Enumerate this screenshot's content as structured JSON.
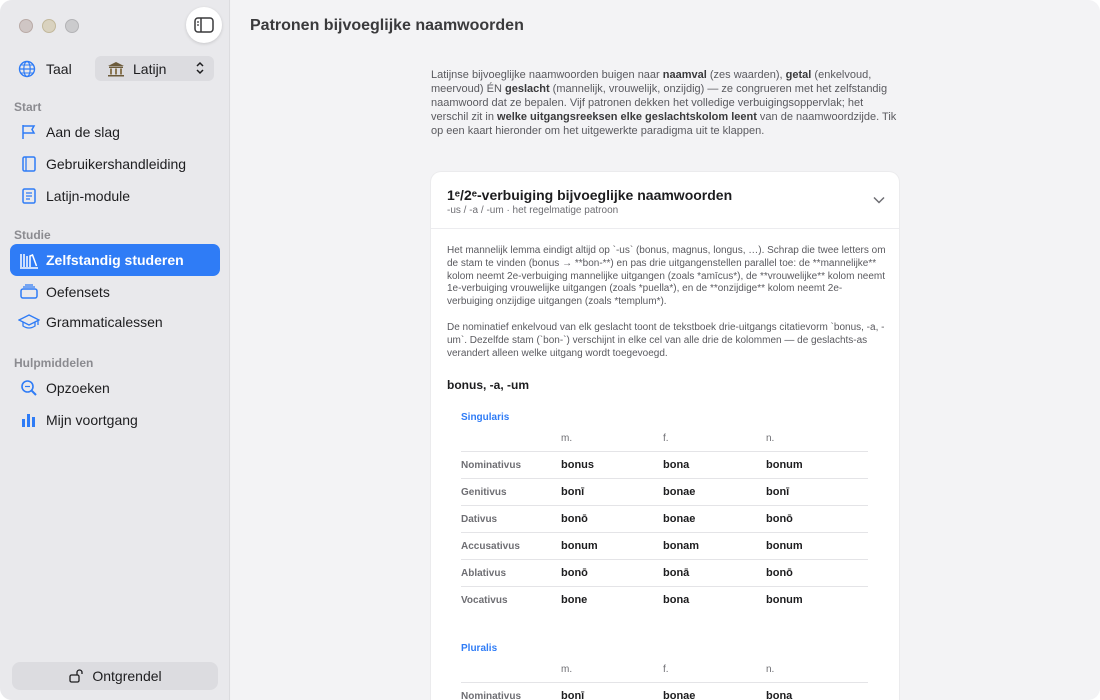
{
  "sidebar": {
    "language_label": "Taal",
    "language_value": "Latijn",
    "sections": {
      "start": "Start",
      "studie": "Studie",
      "hulpmiddelen": "Hulpmiddelen"
    },
    "items": [
      {
        "label": "Aan de slag",
        "icon": "flag-icon"
      },
      {
        "label": "Gebruikershandleiding",
        "icon": "book-icon"
      },
      {
        "label": "Latijn-module",
        "icon": "document-icon"
      },
      {
        "label": "Zelfstandig studeren",
        "icon": "library-icon",
        "active": true
      },
      {
        "label": "Oefensets",
        "icon": "stack-icon"
      },
      {
        "label": "Grammaticalessen",
        "icon": "graduation-cap-icon"
      },
      {
        "label": "Opzoeken",
        "icon": "magnifier-icon"
      },
      {
        "label": "Mijn voortgang",
        "icon": "bar-chart-icon"
      }
    ],
    "unlock_label": "Ontgrendel"
  },
  "main": {
    "title": "Patronen bijvoeglijke naamwoorden",
    "intro": {
      "t1": "Latijnse bijvoeglijke naamwoorden buigen naar ",
      "b1": "naamval",
      "t2": " (zes waarden), ",
      "b2": "getal",
      "t3": " (enkelvoud, meervoud) ÉN ",
      "b3": "geslacht",
      "t4": " (mannelijk, vrouwelijk, onzijdig) — ze congrueren met het zelfstandig naamwoord dat ze bepalen. Vijf patronen dekken het volledige verbuigingsoppervlak; het verschil zit in ",
      "b4": "welke uitgangsreeksen elke geslachtskolom leent",
      "t5": " van de naamwoordzijde. Tik op een kaart hieronder om het uitgewerkte paradigma uit te klappen."
    },
    "card": {
      "title": "1ᵉ/2ᵉ-verbuiging bijvoeglijke naamwoorden",
      "subtitle": "-us / -a / -um · het regelmatige patroon",
      "p1": "Het mannelijk lemma eindigt altijd op `-us` (bonus, magnus, longus, …). Schrap die twee letters om de stam te vinden (bonus → **bon-**) en pas drie uitgangenstellen parallel toe: de **mannelijke** kolom neemt 2e-verbuiging mannelijke uitgangen (zoals *amīcus*), de **vrouwelijke** kolom neemt 1e-verbuiging vrouwelijke uitgangen (zoals *puella*), en de **onzijdige** kolom neemt 2e-verbuiging onzijdige uitgangen (zoals *templum*).",
      "p2": "De nominatief enkelvoud van elk geslacht toont de tekstboek drie-uitgangs citatievorm `bonus, -a, -um`. Dezelfde stam (`bon-`) verschijnt in elke cel van alle drie de kolommen — de geslachts-as verandert alleen welke uitgang wordt toegevoegd.",
      "lemma": "bonus, -a, -um",
      "columns": [
        "m.",
        "f.",
        "n."
      ],
      "singular": {
        "label": "Singularis",
        "rows": [
          {
            "case": "Nominativus",
            "m": "bonus",
            "f": "bona",
            "n": "bonum"
          },
          {
            "case": "Genitivus",
            "m": "bonī",
            "f": "bonae",
            "n": "bonī"
          },
          {
            "case": "Dativus",
            "m": "bonō",
            "f": "bonae",
            "n": "bonō"
          },
          {
            "case": "Accusativus",
            "m": "bonum",
            "f": "bonam",
            "n": "bonum"
          },
          {
            "case": "Ablativus",
            "m": "bonō",
            "f": "bonā",
            "n": "bonō"
          },
          {
            "case": "Vocativus",
            "m": "bone",
            "f": "bona",
            "n": "bonum"
          }
        ]
      },
      "plural": {
        "label": "Pluralis",
        "rows": [
          {
            "case": "Nominativus",
            "m": "bonī",
            "f": "bonae",
            "n": "bona"
          }
        ]
      }
    }
  }
}
